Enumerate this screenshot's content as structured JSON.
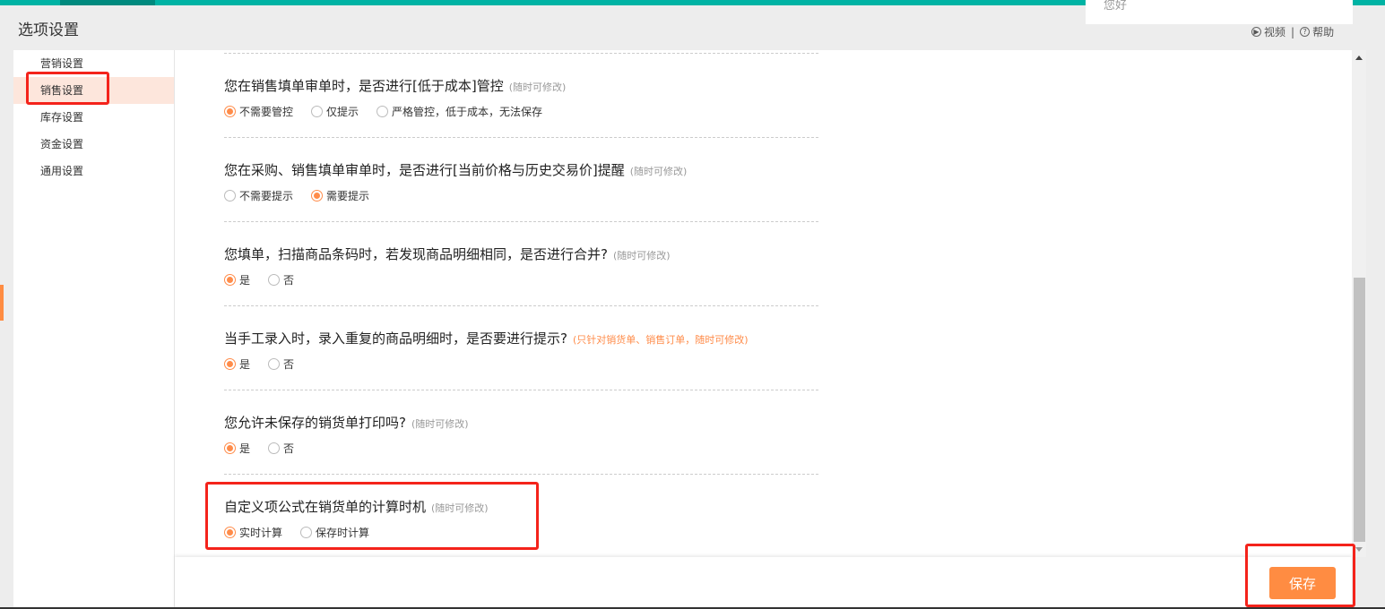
{
  "header": {
    "title": "选项设置",
    "greeting": "您好",
    "video_label": "视频",
    "help_label": "帮助"
  },
  "sidebar": {
    "items": [
      {
        "label": "营销设置"
      },
      {
        "label": "销售设置"
      },
      {
        "label": "库存设置"
      },
      {
        "label": "资金设置"
      },
      {
        "label": "通用设置"
      }
    ],
    "active": "销售设置"
  },
  "sections": [
    {
      "question": "您在销售填单审单时，是否进行[低于成本]管控",
      "note": "(随时可修改)",
      "options": [
        "不需要管控",
        "仅提示",
        "严格管控，低于成本，无法保存"
      ],
      "selected": 0
    },
    {
      "question": "您在采购、销售填单审单时，是否进行[当前价格与历史交易价]提醒",
      "note": "(随时可修改)",
      "options": [
        "不需要提示",
        "需要提示"
      ],
      "selected": 1
    },
    {
      "question": "您填单，扫描商品条码时，若发现商品明细相同，是否进行合并?",
      "note": "(随时可修改)",
      "options": [
        "是",
        "否"
      ],
      "selected": 0
    },
    {
      "question": "当手工录入时，录入重复的商品明细时，是否要进行提示?",
      "note": "(只针对销货单、销售订单，随时可修改)",
      "options": [
        "是",
        "否"
      ],
      "selected": 0
    },
    {
      "question": "您允许未保存的销货单打印吗?",
      "note": "(随时可修改)",
      "options": [
        "是",
        "否"
      ],
      "selected": 0
    },
    {
      "question": "自定义项公式在销货单的计算时机",
      "note": "(随时可修改)",
      "options": [
        "实时计算",
        "保存时计算"
      ],
      "selected": 0
    }
  ],
  "footer": {
    "save_label": "保存"
  },
  "colors": {
    "accent": "#ff8c42",
    "teal": "#00b3a4",
    "highlight": "#f4231b"
  }
}
